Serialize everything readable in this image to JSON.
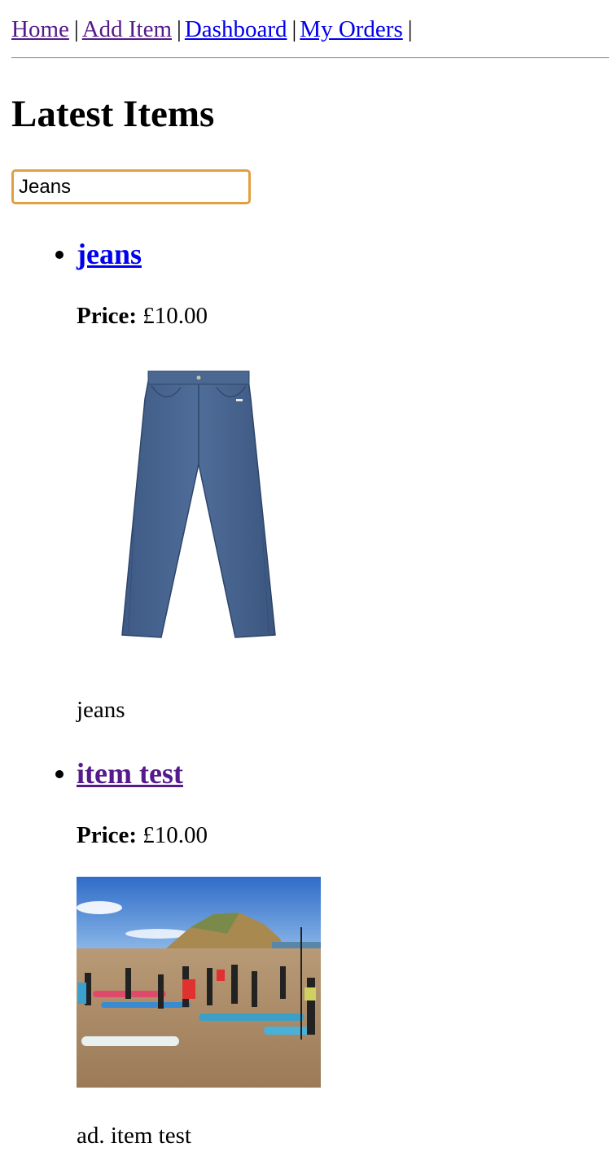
{
  "nav": {
    "links": [
      {
        "label": "Home"
      },
      {
        "label": "Add Item"
      },
      {
        "label": "Dashboard"
      },
      {
        "label": "My Orders"
      }
    ],
    "separator": "|"
  },
  "page": {
    "title": "Latest Items"
  },
  "search": {
    "value": "Jeans"
  },
  "items": [
    {
      "title": "jeans",
      "price_label": "Price:",
      "price_value": "£10.00",
      "image_icon": "jeans-photo",
      "description": "jeans"
    },
    {
      "title": "item test",
      "price_label": "Price:",
      "price_value": "£10.00",
      "image_icon": "beach-paddleboard-photo",
      "description": "ad. item test"
    }
  ]
}
